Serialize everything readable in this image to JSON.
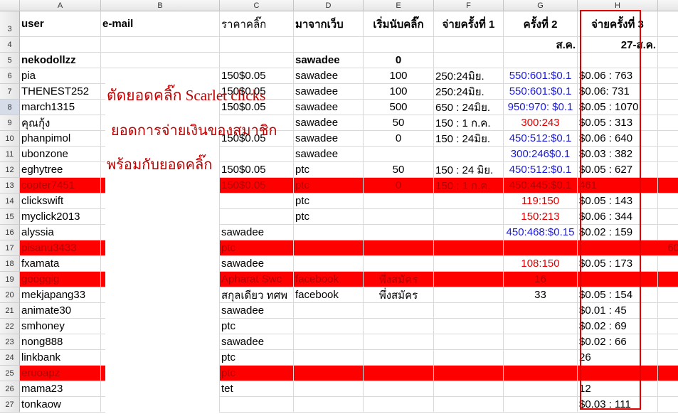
{
  "columns": [
    "A",
    "B",
    "C",
    "D",
    "E",
    "F",
    "G",
    "H"
  ],
  "headers": {
    "row3": {
      "a": "user",
      "b": "e-mail",
      "c": "ราคาคลิ๊ก",
      "d": "มาจากเว็บ",
      "e": "เริ่มนับคลิ๊ก",
      "f": "จ่ายครั้งที่ 1",
      "g": "ครั้งที่ 2",
      "h": "จ่ายครั้งที่ 3"
    },
    "row4": {
      "g": "ส.ค.",
      "h": "27-ส.ค."
    }
  },
  "rows": [
    {
      "n": "5",
      "a": "nekodollzz",
      "d": "sawadee",
      "e": "0"
    },
    {
      "n": "6",
      "a": "pia",
      "c": "150$0.05",
      "d": "sawadee",
      "e": "100",
      "f": "250:24มิย.",
      "g": "550:601:$0.1",
      "h": "$0.06 : 763"
    },
    {
      "n": "7",
      "a": "THENEST252",
      "c": "150$0.05",
      "d": "sawadee",
      "e": "100",
      "f": "250:24มิย.",
      "g": "550:601:$0.1",
      "h": "$0.06: 731"
    },
    {
      "n": "8",
      "a": "march1315",
      "c": "150$0.05",
      "d": "sawadee",
      "e": "500",
      "f": "650 : 24มิย.",
      "g": "950:970: $0.1",
      "h": "$0.05 : 1070"
    },
    {
      "n": "9",
      "a": "คุณกุ้ง",
      "d": "sawadee",
      "e": "50",
      "f": "150 : 1 ก.ค.",
      "g": "300:243",
      "h": "$0.05 : 313"
    },
    {
      "n": "10",
      "a": "phanpimol",
      "c": "150$0.05",
      "d": "sawadee",
      "e": "0",
      "f": "150 : 24มิย.",
      "g": "450:512:$0.1",
      "h": "$0.06 : 640"
    },
    {
      "n": "11",
      "a": "ubonzone",
      "d": "sawadee",
      "g": "300:246$0.1",
      "h": "$0.03 : 382"
    },
    {
      "n": "12",
      "a": "eghytree",
      "c": "150$0.05",
      "d": "ptc",
      "e": "50",
      "f": "150 : 24 มิย.",
      "g": "450:512:$0.1",
      "h": "$0.05 : 627"
    },
    {
      "n": "13",
      "a": "copter7451",
      "c": "150$0.05",
      "d": "ptc",
      "e": "0",
      "f": "150 : 1 ก.ค.",
      "g": "450:445:$0.1",
      "h": "461"
    },
    {
      "n": "14",
      "a": " clickswift",
      "d": "ptc",
      "g": "119:150",
      "h": "$0.05  : 143"
    },
    {
      "n": "15",
      "a": "myclick2013",
      "d": "ptc",
      "g": "150:213",
      "h": "$0.06 : 344"
    },
    {
      "n": "16",
      "a": "alyssia",
      "c": "sawadee",
      "g": "450:468:$0.15",
      "h": "$0.02 : 159"
    },
    {
      "n": "17",
      "a": "pisanu3433",
      "c": "ptc",
      "h": "60"
    },
    {
      "n": "18",
      "a": "fxamata",
      "c": "sawadee",
      "g": "108:150",
      "h": "$0.05 : 173"
    },
    {
      "n": "19",
      "a": "googgig",
      "c": "Apharat Swc",
      "d": "facebook",
      "e": "พึ่งสมัคร",
      "g": "16"
    },
    {
      "n": "20",
      "a": "mekjapang33",
      "c": "สกุลเดียว ทศพ",
      "d": "facebook",
      "e": "พึ่งสมัคร",
      "g": "33",
      "h": "$0.05 : 154"
    },
    {
      "n": "21",
      "a": "animate30",
      "c": "sawadee",
      "h": "$0.01 : 45"
    },
    {
      "n": "22",
      "a": "smhoney",
      "c": "ptc",
      "h": "$0.02 : 69"
    },
    {
      "n": "23",
      "a": "nong888",
      "c": "sawadee",
      "h": "$0.02 : 66"
    },
    {
      "n": "24",
      "a": "linkbank",
      "c": "ptc",
      "h": "26"
    },
    {
      "n": "25",
      "a": "eruoapz",
      "c": "ptc"
    },
    {
      "n": "26",
      "a": "mama23",
      "c": "tet",
      "h": "12"
    },
    {
      "n": "27",
      "a": "tonkaow",
      "h": "$0.03 : 111"
    }
  ],
  "overlay": {
    "line1": "ตัดยอดคลิ๊ก Scarlet clicks",
    "line2": "ยอดการจ่ายเงินของสมาชิก",
    "line3": "พร้อมกับยอดคลิ๊ก"
  },
  "colors": {
    "highlight_row": "#ff0000",
    "value_blue": "#1a1ae0",
    "value_red": "#e00000",
    "annotation": "#c00000"
  }
}
